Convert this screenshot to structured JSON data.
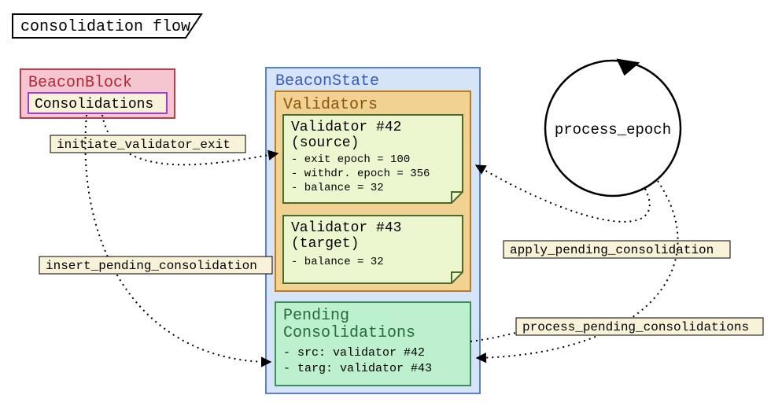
{
  "title": "consolidation flow",
  "beaconblock": {
    "label": "BeaconBlock",
    "consolidations_label": "Consolidations"
  },
  "edges": {
    "initiate_validator_exit": "initiate_validator_exit",
    "insert_pending_consolidation": "insert_pending_consolidation",
    "apply_pending_consolidation": "apply_pending_consolidation",
    "process_pending_consolidations": "process_pending_consolidations"
  },
  "beaconstate": {
    "label": "BeaconState",
    "validators": {
      "label": "Validators",
      "source": {
        "title1": "Validator #42",
        "title2": "(source)",
        "line1": "- exit epoch   = 100",
        "line2": "- withdr. epoch = 356",
        "line3": "- balance      = 32"
      },
      "target": {
        "title1": "Validator #43",
        "title2": "(target)",
        "line1": "- balance = 32"
      }
    },
    "pending": {
      "label1": "Pending",
      "label2": "Consolidations",
      "line1": "- src:  validator #42",
      "line2": "- targ: validator #43"
    }
  },
  "process_epoch": "process_epoch"
}
